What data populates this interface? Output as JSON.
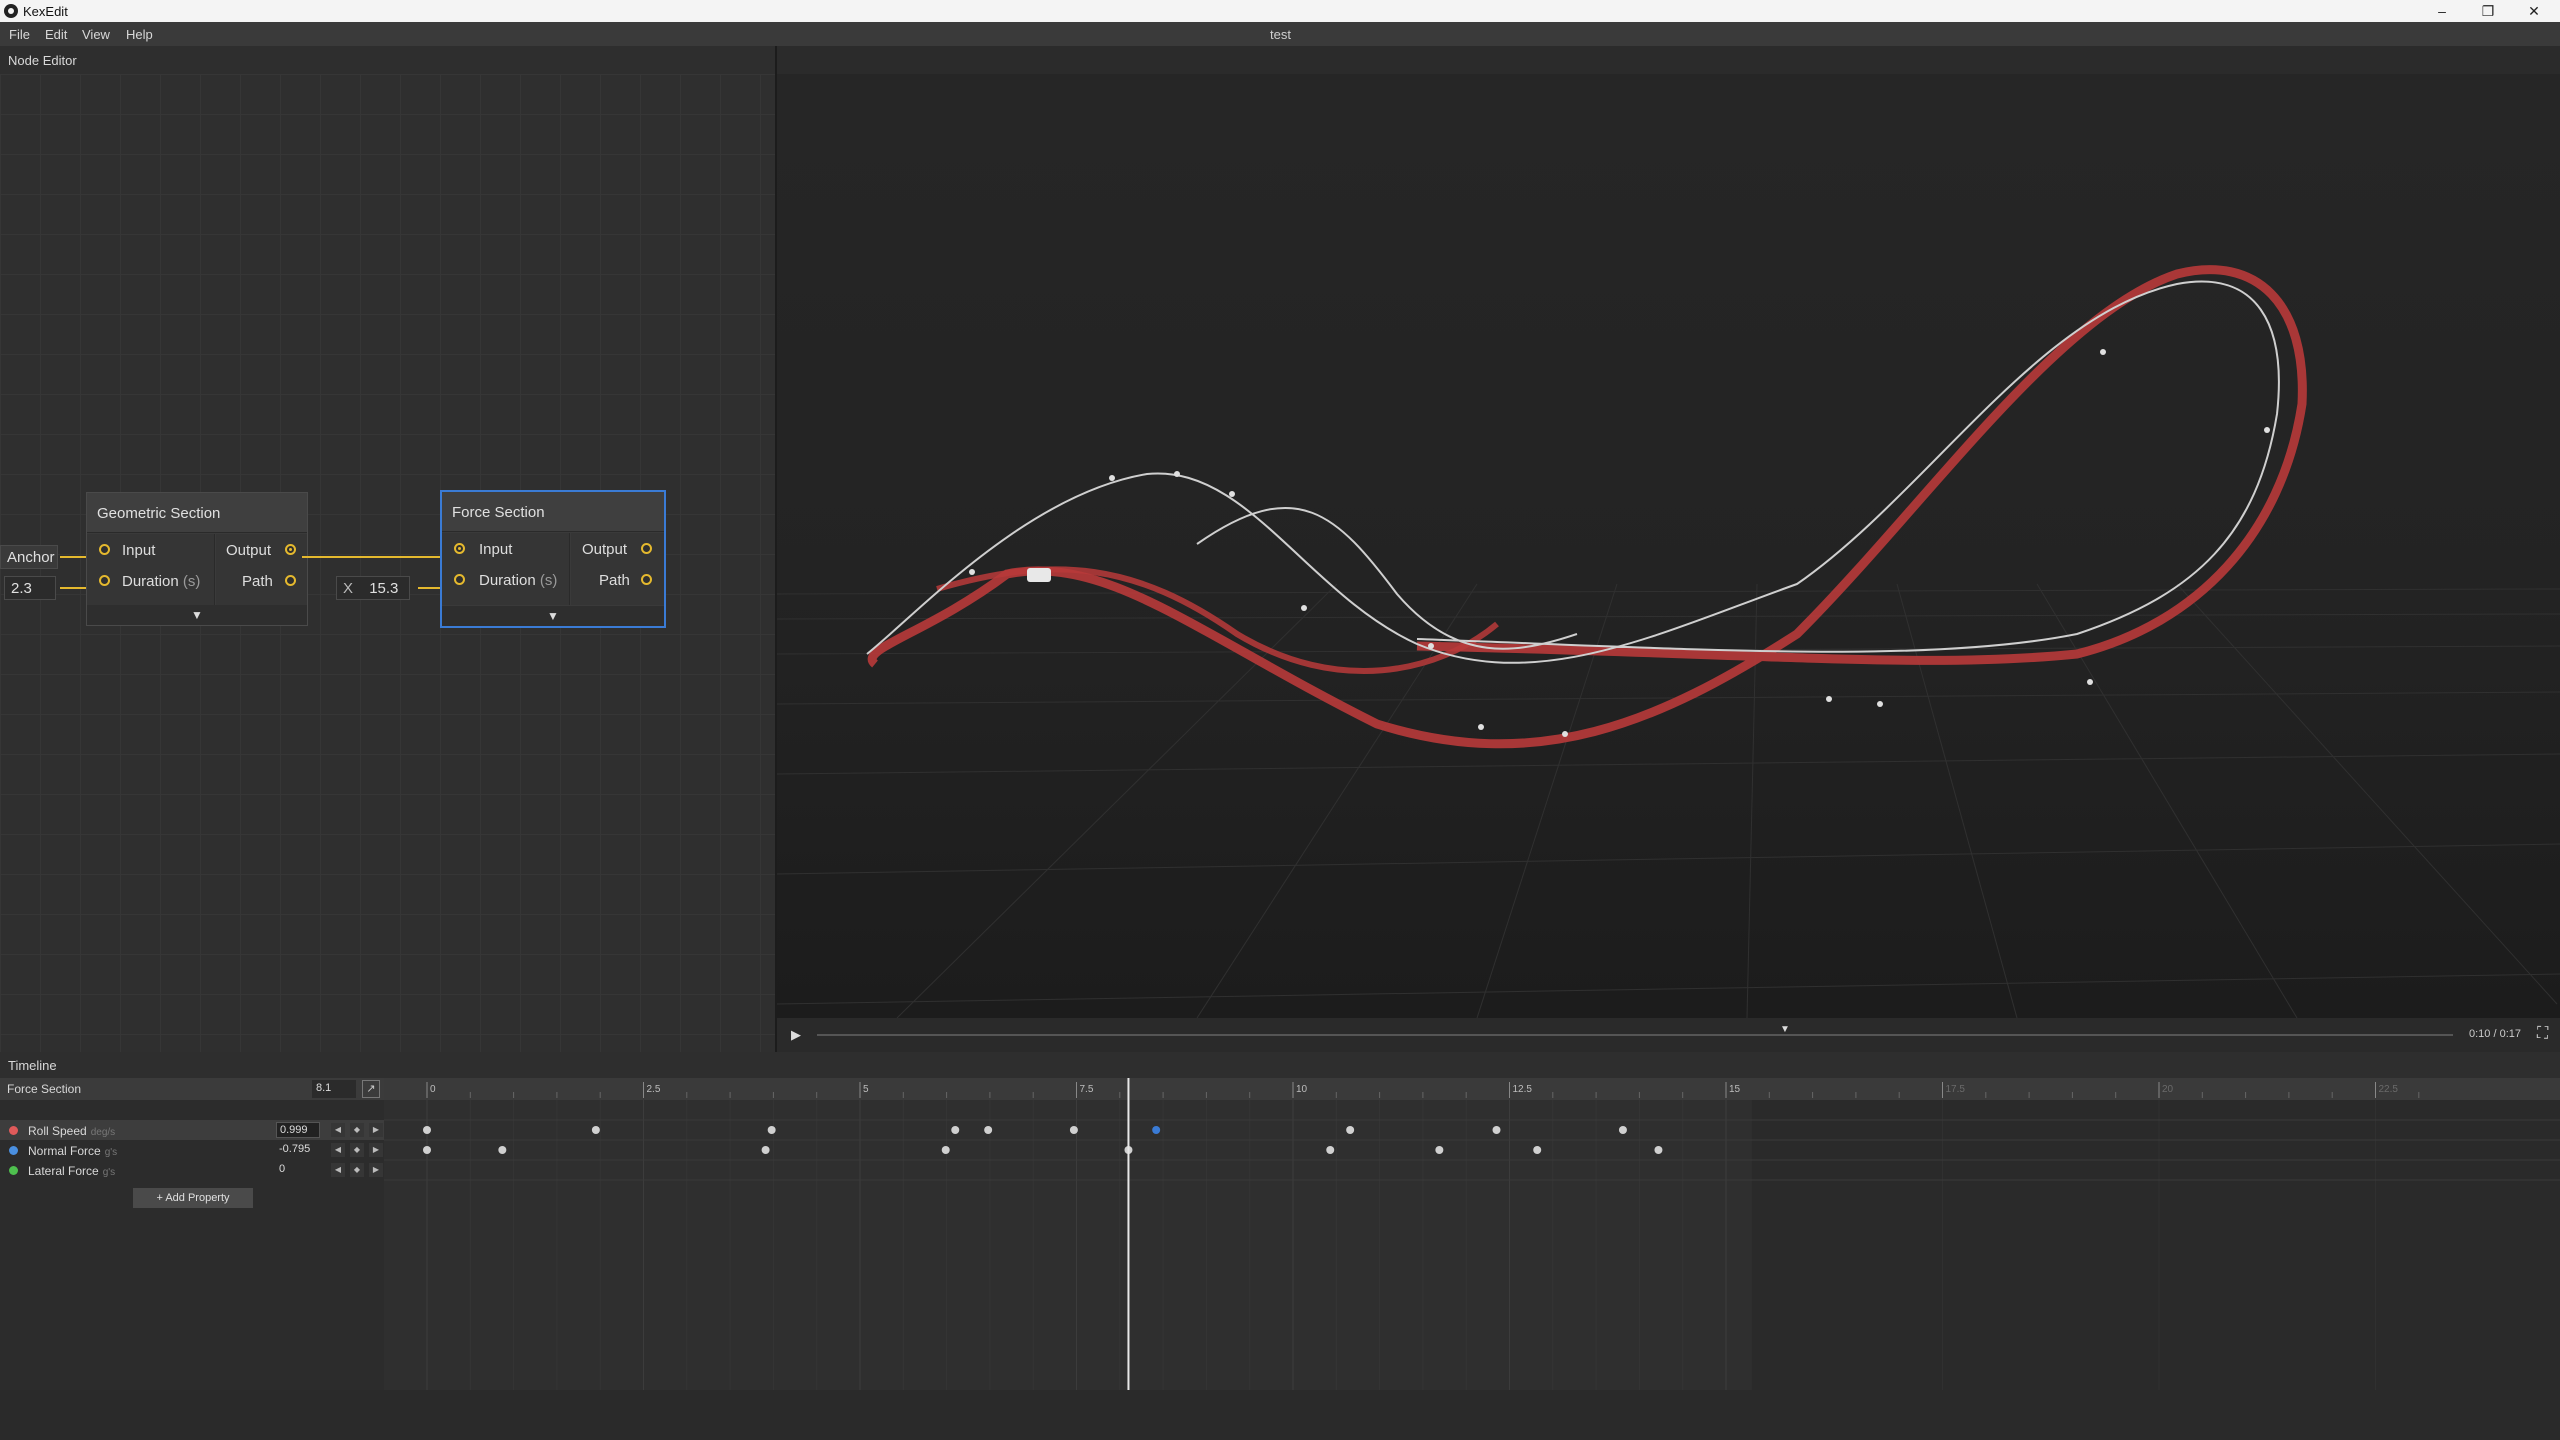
{
  "window": {
    "app_title": "KexEdit",
    "minimize_icon": "–",
    "restore_icon": "❐",
    "close_icon": "✕"
  },
  "menu": {
    "items": [
      "File",
      "Edit",
      "View",
      "Help"
    ],
    "document_title": "test"
  },
  "node_editor": {
    "title": "Node Editor",
    "anchor_label": "Anchor",
    "anchor_value": "2.3",
    "geometric_node": {
      "title": "Geometric Section",
      "input_label": "Input",
      "duration_label": "Duration",
      "duration_unit": "(s)",
      "output_label": "Output",
      "path_label": "Path",
      "expand_icon": "▼"
    },
    "force_duration_prefix": "X",
    "force_duration_value": "15.3",
    "force_node": {
      "title": "Force Section",
      "input_label": "Input",
      "duration_label": "Duration",
      "duration_unit": "(s)",
      "output_label": "Output",
      "path_label": "Path",
      "expand_icon": "▼"
    }
  },
  "viewport": {
    "play_icon": "▶",
    "scrub_marker_icon": "▼",
    "time_display": "0:10 / 0:17",
    "fullscreen_icon": "⛶",
    "playback_fraction": 0.59
  },
  "timeline": {
    "title": "Timeline",
    "section_name": "Force Section",
    "section_value": "8.1",
    "graph_icon": "↗",
    "ruler_labels": [
      "0",
      "2.5",
      "5",
      "7.5",
      "10",
      "12.5",
      "15",
      "17.5",
      "20",
      "22.5"
    ],
    "playhead_time": 8.1,
    "section_duration": 15.3,
    "properties": [
      {
        "name": "Roll Speed",
        "unit": "deg/s",
        "value": "0.999",
        "color": "#e05a5a",
        "boxed": true,
        "selected": true,
        "keyframes": [
          0,
          1.95,
          3.98,
          6.1,
          6.48,
          7.47,
          8.42,
          10.66,
          12.35,
          13.81
        ]
      },
      {
        "name": "Normal Force",
        "unit": "g's",
        "value": "-0.795",
        "color": "#4a8fe0",
        "boxed": false,
        "selected": false,
        "keyframes": [
          0,
          0.87,
          3.91,
          5.99,
          8.1,
          10.43,
          11.69,
          12.82,
          14.22
        ]
      },
      {
        "name": "Lateral Force",
        "unit": "g's",
        "value": "0",
        "color": "#4ec04e",
        "boxed": false,
        "selected": false,
        "keyframes": []
      }
    ],
    "prev_key_icon": "◀",
    "add_key_icon": "◆",
    "next_key_icon": "▶",
    "add_property_label": "+ Add Property",
    "selected_keyframe_color": "#3a7bd5"
  },
  "colors": {
    "wire": "#e5b92e",
    "selected_node_border": "#3a7bd5",
    "track_red": "#b83a3a"
  }
}
